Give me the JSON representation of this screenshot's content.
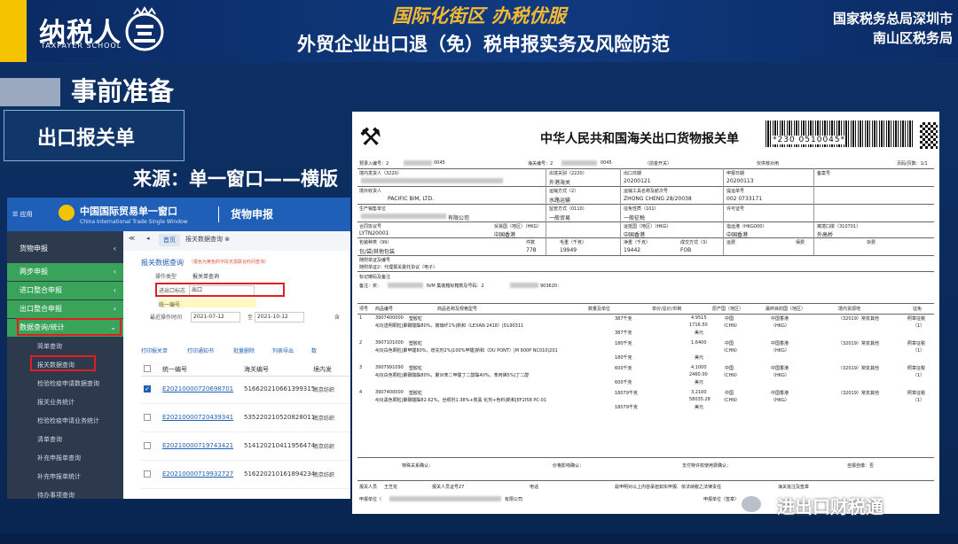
{
  "slide": {
    "logo": {
      "text": "纳税人",
      "sub": "TAXPAYER SCHOOL"
    },
    "slogan": "国际化街区 办税优服",
    "title": "外贸企业出口退（免）税申报实务及风险防范",
    "org": {
      "line1": "国家税务总局深圳市",
      "line2": "南山区税务局"
    },
    "section_title": "事前准备",
    "subtitle": "出口报关单",
    "source_text": "来源：单一窗口——横版",
    "watermark": "进出口财税通"
  },
  "screenshot": {
    "header": {
      "menu": "☰ 应用",
      "cn": "中国国际贸易单一窗口",
      "en": "China International Trade Single Window",
      "module": "货物申报"
    },
    "sidebar": [
      {
        "label": "货物申报",
        "chev": "‹"
      },
      {
        "label": "两步申报",
        "chev": "‹"
      },
      {
        "label": "进口整合申报",
        "chev": "‹"
      },
      {
        "label": "出口整合申报",
        "chev": "‹"
      },
      {
        "label": "数据查询/统计",
        "chev": "⌄"
      },
      {
        "label": "简单查询"
      },
      {
        "label": "报关数据查询"
      },
      {
        "label": "检验检疫申请数据查询"
      },
      {
        "label": "报关业务统计"
      },
      {
        "label": "检验检疫申请业务统计"
      },
      {
        "label": "清单查询"
      },
      {
        "label": "补充申报单查询"
      },
      {
        "label": "补充申报单统计"
      },
      {
        "label": "待办事项查询"
      }
    ],
    "tabs": [
      "首页",
      "报关数据查询 ⊗"
    ],
    "query": {
      "title": "报关数据查询",
      "note": "（报色为黄色的字段无需联合时间查询）",
      "op_type_label": "操作类型",
      "op_type_value": "报关单查询",
      "ie_flag_label": "进出口标志",
      "ie_flag_value": "出口",
      "unified_no_label": "统一编号",
      "time_label": "最近操作时间",
      "date_from": "2021-07-12",
      "date_to": "2021-10-12",
      "date_sep": "至",
      "radio_label": "含"
    },
    "toolbar": [
      "打印报关单",
      "打印通知书",
      "批量删除",
      "列表导出",
      "数"
    ],
    "columns": [
      "统一编号",
      "海关编号",
      "境内发"
    ],
    "rows": [
      {
        "id": "E20210000720698701",
        "customs": "516620210661399315",
        "co": "南京纺织",
        "checked": true
      },
      {
        "id": "E20210000720439341",
        "customs": "535220210520828011",
        "co": "南京纺织",
        "checked": false
      },
      {
        "id": "E20210000719743421",
        "customs": "514120210411956474",
        "co": "南京纺织",
        "checked": false
      },
      {
        "id": "E20210000719932727",
        "customs": "516220210161894234",
        "co": "南京纺织",
        "checked": false
      }
    ]
  },
  "form": {
    "title": "中华人民共和国海关出口货物报关单",
    "barcode_text": "*230         0510045*",
    "header_row": {
      "pre_entry": "预录入编号：2",
      "pre_entry_tail": "0045",
      "customs_no": "海关编号：2",
      "customs_tail": "0045",
      "port": "（前金开关）",
      "print": "仅供核对用",
      "page": "页码/页数：1/1"
    },
    "row1": {
      "consignor": "境内发货人（3220）",
      "exit_port": "出境关别（2220）",
      "exit_port_v": "外港海关",
      "export_date": "出口日期",
      "export_date_v": "20200121",
      "decl_date": "申报日期",
      "decl_date_v": "20200113",
      "record": "备案号"
    },
    "row2": {
      "consignee": "境外收货人",
      "consignee_v": "PACIFIC BIM, LTD.",
      "transport": "运输方式（2）",
      "transport_v": "水路运输",
      "vessel": "运输工具名称及航次号",
      "vessel_v": "ZHONG CHENG 28/20038",
      "bl": "提运单号",
      "bl_v": "002           0733171"
    },
    "row3": {
      "producer": "生产销售单位",
      "producer_tail": "有限公司",
      "supervision": "监管方式（0110）",
      "supervision_v": "一般贸易",
      "levy": "征免性质（101）",
      "levy_v": "一般征税",
      "license": "许可证号"
    },
    "row4": {
      "contract": "合同协议号",
      "contract_v": "LYTN20001",
      "trade_country": "贸易国（地区）（HKG）",
      "trade_country_v": "中国香港",
      "dest_country": "运抵国（地区）（HKG）",
      "dest_country_v": "中国香港",
      "via_port": "指运港（HKG000）",
      "via_port_v": "中国香港",
      "exit_port2": "离境口岸（310701）",
      "exit_port2_v": "外高桥"
    },
    "row5": {
      "pkg": "包装种类（99）",
      "pkg_v": "包/袋/其他包装",
      "pieces": "件数",
      "pieces_v": "778",
      "gross": "毛重（千克）",
      "gross_v": "19949",
      "net": "净重（千克）",
      "net_v": "19442",
      "deal": "成交方式（3）",
      "deal_v": "FOB",
      "freight": "运费",
      "insurance": "保费",
      "misc": "杂费"
    },
    "docs": "随附单证及编号",
    "docs_v": "随附单证2：代理报关委托协议（电子）",
    "marks": "标记唛码及备注",
    "remark": "备注：奖：",
    "remark_mid": "N/M  集装箱标箱数及号码：2",
    "remark_tail": "903620：",
    "item_cols": [
      "项号",
      "商品编号",
      "商品名称及规格型号",
      "数量及单位",
      "单价/总价/币制",
      "原产国（地区）",
      "最终目的国（地区）",
      "境内货源地",
      "征免"
    ],
    "items": [
      {
        "no": "1",
        "code": "3907400000",
        "name": "塑胶粒",
        "spec": "4|0|透明颗粒|聚碳酸酯80%，玻璃纤1%|新和（LEXAN 2418）|DL90311",
        "qty1": "387千克",
        "qty2": "387千克",
        "price": "4.9515",
        "total": "1716.50",
        "cur": "美元",
        "origin": "中国",
        "origin_code": "（CHN）",
        "dest": "中国香港",
        "dest_code": "（HKG）",
        "src": "（32019）常泉其他",
        "levy": "照章征税",
        "levy_no": "（1）"
      },
      {
        "no": "2",
        "code": "3907101000",
        "name": "塑胶粒",
        "spec": "4|0|白色颗粒|聚甲醛80%，增充剂2%|100%甲醛|新和（DU PONT）|M 900P NC010|201",
        "qty1": "180千克",
        "qty2": "180千克",
        "price": "1.6400",
        "total": "",
        "cur": "美元",
        "origin": "中国",
        "origin_code": "（CHN）",
        "dest": "中国香港",
        "dest_code": "（HKG）",
        "src": "（32019）常泉其他",
        "levy": "照章征税",
        "levy_no": "（1）"
      },
      {
        "no": "3",
        "code": "3907991090",
        "name": "塑胶粒",
        "spec": "4|0|白色颗粒|聚碳酸酯80%，聚对苯二甲酸丁二醇酯40%，苯丙烯5%|丁二醇",
        "qty1": "600千克",
        "qty2": "600千克",
        "price": "4.1000",
        "total": "2460.00",
        "cur": "美元",
        "origin": "中国",
        "origin_code": "（CHN）",
        "dest": "中国香港",
        "dest_code": "（HKG）",
        "src": "（32019）常泉其他",
        "levy": "照章征税",
        "levy_no": "（1）"
      },
      {
        "no": "4",
        "code": "3907400000",
        "name": "塑胶粒",
        "spec": "4|0|黑色颗粒|聚碳酸酯82.62%，丝绸剂1.38%+炭黑 化剂+色料|新和|EF2I58 PC-01",
        "qty1": "18079千克",
        "qty2": "18079千克",
        "price": "3.2100",
        "total": "58035.28",
        "cur": "美元",
        "origin": "中国",
        "origin_code": "（CHN）",
        "dest": "中国香港",
        "dest_code": "（HKG）",
        "src": "（32019）常泉其他",
        "levy": "照章征税",
        "levy_no": "（1）"
      }
    ],
    "footer": {
      "special": "特殊关系确认：",
      "price_effect": "价格影响确认：",
      "royalty": "支付特许权使用费确认：",
      "self_report": "自报自缴：否",
      "declarant": "报关人员",
      "declarant_v": "王芝花",
      "decl_no": "报关人员证号27",
      "tel": "电话",
      "statement": "兹申明对以上内容承担如实申报、依法纳税之法律责任",
      "customs_note": "海关批注及签章",
      "unit": "申报单位（",
      "unit_tail": "有限公司",
      "unit_sign": "申报单位（签章）"
    }
  },
  "colors": {
    "slogan": "#f6b935",
    "accent_yellow": "#f4c400",
    "sw_blue": "#1f5fb8",
    "sw_green": "#3aa35a",
    "highlight_red": "#e02020"
  }
}
